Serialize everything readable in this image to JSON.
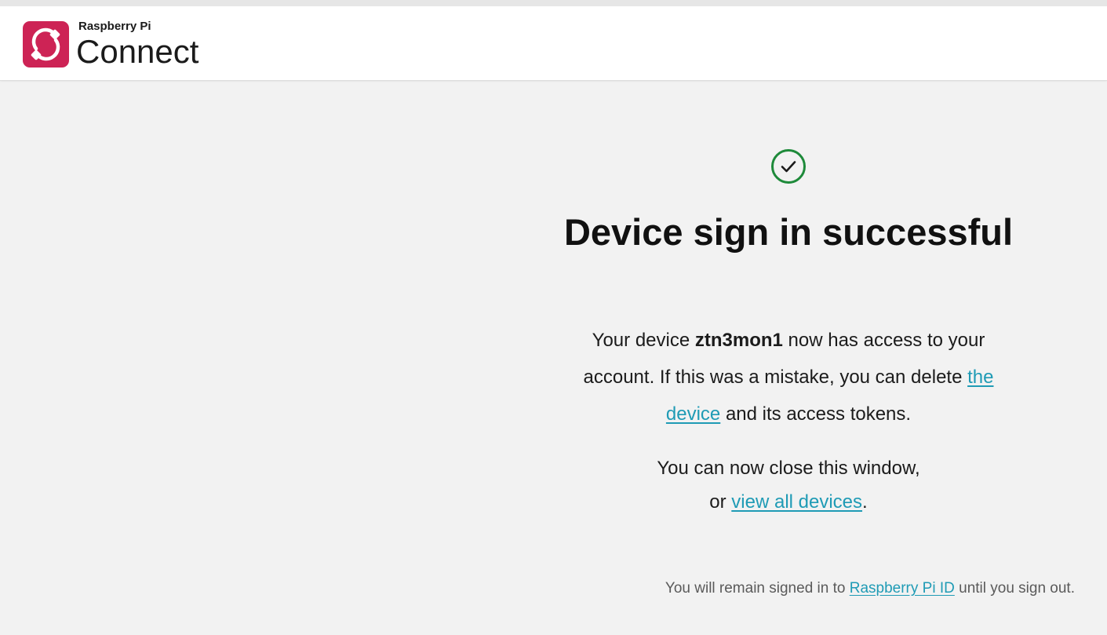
{
  "header": {
    "brand_small": "Raspberry Pi",
    "brand_large": "Connect",
    "logo_icon": "raspberry-pi-connect-logo-icon",
    "logo_color": "#cd2355"
  },
  "main": {
    "status_icon": "check-circle-icon",
    "status_color": "#1e8a3a",
    "title": "Device sign in successful",
    "message": {
      "line1_prefix": "Your device ",
      "device_name": "ztn3mon1",
      "line1_suffix": " now has access to your",
      "line2_prefix": "account. If this was a mistake, you can delete ",
      "device_link_part1": "the",
      "device_link_part2": "device",
      "line3_suffix": " and its access tokens."
    },
    "close": {
      "line1": "You can now close this window,",
      "line2_prefix": "or ",
      "view_all_link": "view all devices",
      "line2_suffix": "."
    },
    "footer": {
      "prefix": "You will remain signed in to ",
      "id_link": "Raspberry Pi ID",
      "suffix": " until you sign out."
    },
    "link_color": "#1f9bb5"
  }
}
